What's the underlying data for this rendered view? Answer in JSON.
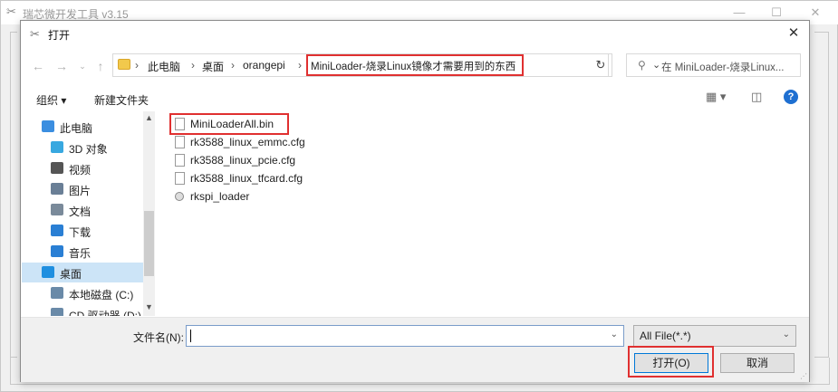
{
  "app": {
    "title": "瑞芯微开发工具 v3.15",
    "minimize_icon": "—",
    "maximize_icon": "☐",
    "close_icon": "✕"
  },
  "dialog": {
    "title": "打开",
    "close_icon": "✕"
  },
  "navigation": {
    "back_icon": "←",
    "forward_icon": "→",
    "up_icon": "↑",
    "dropdown_icon": "⌄",
    "breadcrumb": [
      "此电脑",
      "桌面",
      "orangepi",
      "MiniLoader-烧录Linux镜像才需要用到的东西"
    ],
    "separator": "›",
    "highlight_color": "#e03030",
    "refresh_icon": "↻",
    "search_placeholder": "在 MiniLoader-烧录Linux..."
  },
  "toolbar": {
    "organize": "组织 ▾",
    "new_folder": "新建文件夹",
    "view_icon": "▦ ▾",
    "pane_icon": "◫",
    "help": "?"
  },
  "sidebar": {
    "items": [
      {
        "label": "此电脑",
        "icon": "computer-icon",
        "color": "#3b8ee0"
      },
      {
        "label": "3D 对象",
        "icon": "cube-icon",
        "color": "#38a8e0"
      },
      {
        "label": "视频",
        "icon": "film-icon",
        "color": "#555555"
      },
      {
        "label": "图片",
        "icon": "picture-icon",
        "color": "#6a7f96"
      },
      {
        "label": "文档",
        "icon": "document-icon",
        "color": "#7a8a9a"
      },
      {
        "label": "下载",
        "icon": "download-icon",
        "color": "#2a7fd4"
      },
      {
        "label": "音乐",
        "icon": "music-icon",
        "color": "#2a7fd4"
      },
      {
        "label": "桌面",
        "icon": "desktop-icon",
        "color": "#1f8fe0"
      },
      {
        "label": "本地磁盘 (C:)",
        "icon": "drive-icon",
        "color": "#6a8aa8"
      },
      {
        "label": "CD 驱动器 (D:)",
        "icon": "cd-drive-icon",
        "color": "#6a8aa8"
      }
    ],
    "selected_index": 7
  },
  "files": [
    {
      "name": "MiniLoaderAll.bin",
      "icon": "file-icon"
    },
    {
      "name": "rk3588_linux_emmc.cfg",
      "icon": "file-icon"
    },
    {
      "name": "rk3588_linux_pcie.cfg",
      "icon": "file-icon"
    },
    {
      "name": "rk3588_linux_tfcard.cfg",
      "icon": "file-icon"
    },
    {
      "name": "rkspi_loader",
      "icon": "settings-file-icon"
    }
  ],
  "bottom": {
    "filename_label": "文件名(N):",
    "filename_value": "",
    "filter_value": "All File(*.*)",
    "open_button": "打开(O)",
    "cancel_button": "取消",
    "dropdown_icon": "⌄"
  }
}
